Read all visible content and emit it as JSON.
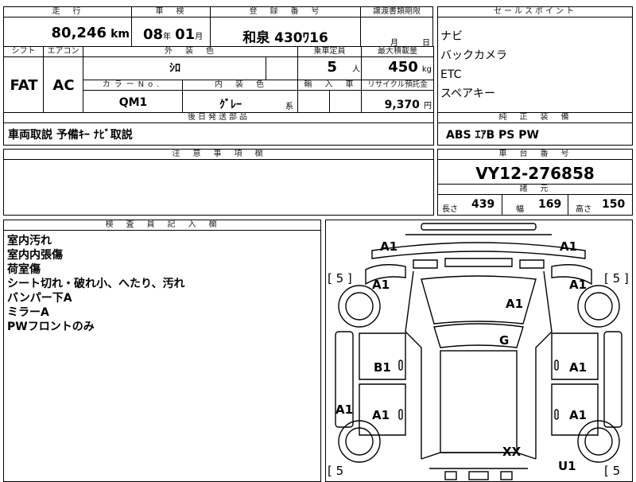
{
  "headers": {
    "mileage": "走　行",
    "inspection": "車　検",
    "registration": "登　録　番　号",
    "transfer_date": "譲渡書類期限",
    "sales_points": "セールスポイント",
    "shift": "シフト",
    "aircon": "エアコン",
    "exterior_color": "外　装　色",
    "capacity": "乗車定員",
    "max_load": "最大積載量",
    "color_no": "カラーNo.",
    "interior_color": "内　装　色",
    "import": "輸　入　車",
    "recycle": "リサイクル預託金",
    "accessories": "後日発送部品",
    "oem_equipment": "純　正　装　備",
    "notes": "注　意　事　項　欄",
    "chassis": "車　台　番　号",
    "specs": "諸　元",
    "inspector": "検　査　員　記　入　欄"
  },
  "mileage": {
    "value": "80,246",
    "unit": "km"
  },
  "inspection": {
    "year": "08",
    "year_unit": "年",
    "month": "01",
    "month_unit": "月"
  },
  "registration": {
    "value": "和泉 430ﾜ16"
  },
  "transfer_date": {
    "month_unit": "月",
    "day_unit": "日"
  },
  "sales_points": [
    "ナビ",
    "バックカメラ",
    "ETC",
    "スペアキー"
  ],
  "shift": "FAT",
  "aircon": "AC",
  "exterior_color": "ｼﾛ",
  "capacity": {
    "value": "5",
    "unit": "人"
  },
  "max_load": {
    "value": "450",
    "unit": "kg"
  },
  "color_no": "QM1",
  "interior_color": {
    "value": "ｸﾞﾚｰ",
    "suffix": "系"
  },
  "recycle": {
    "value": "9,370",
    "unit": "円"
  },
  "accessories": "車両取説 予備ｷｰ ﾅﾋﾞ取説",
  "oem_equipment": "ABS ｴｱB PS PW",
  "chassis": "VY12-276858",
  "specs": {
    "length_label": "長さ",
    "length": "439",
    "width_label": "幅",
    "width": "169",
    "height_label": "高さ",
    "height": "150"
  },
  "inspector_notes": [
    "室内汚れ",
    "室内内張傷",
    "荷室傷",
    "シート切れ・破れ小、へたり、汚れ",
    "バンパー下A",
    "ミラーA",
    "PWフロントのみ"
  ],
  "diagram_marks": {
    "front_left": "A1",
    "front_right": "A1",
    "tire_left": "[ 5 ]",
    "tire_right": "[ 5 ]",
    "fender_left": "A1",
    "fender_right": "A1",
    "hood": "A1",
    "windshield": "G",
    "door_fl": "B1",
    "door_fr": "A1",
    "rocker_left": "A1",
    "door_rl": "A1",
    "door_rr": "A1",
    "roof_rear": "XX",
    "quarter_right": "U1",
    "tire_rear_left": "[ 5",
    "tire_rear_right": "[ 5"
  }
}
